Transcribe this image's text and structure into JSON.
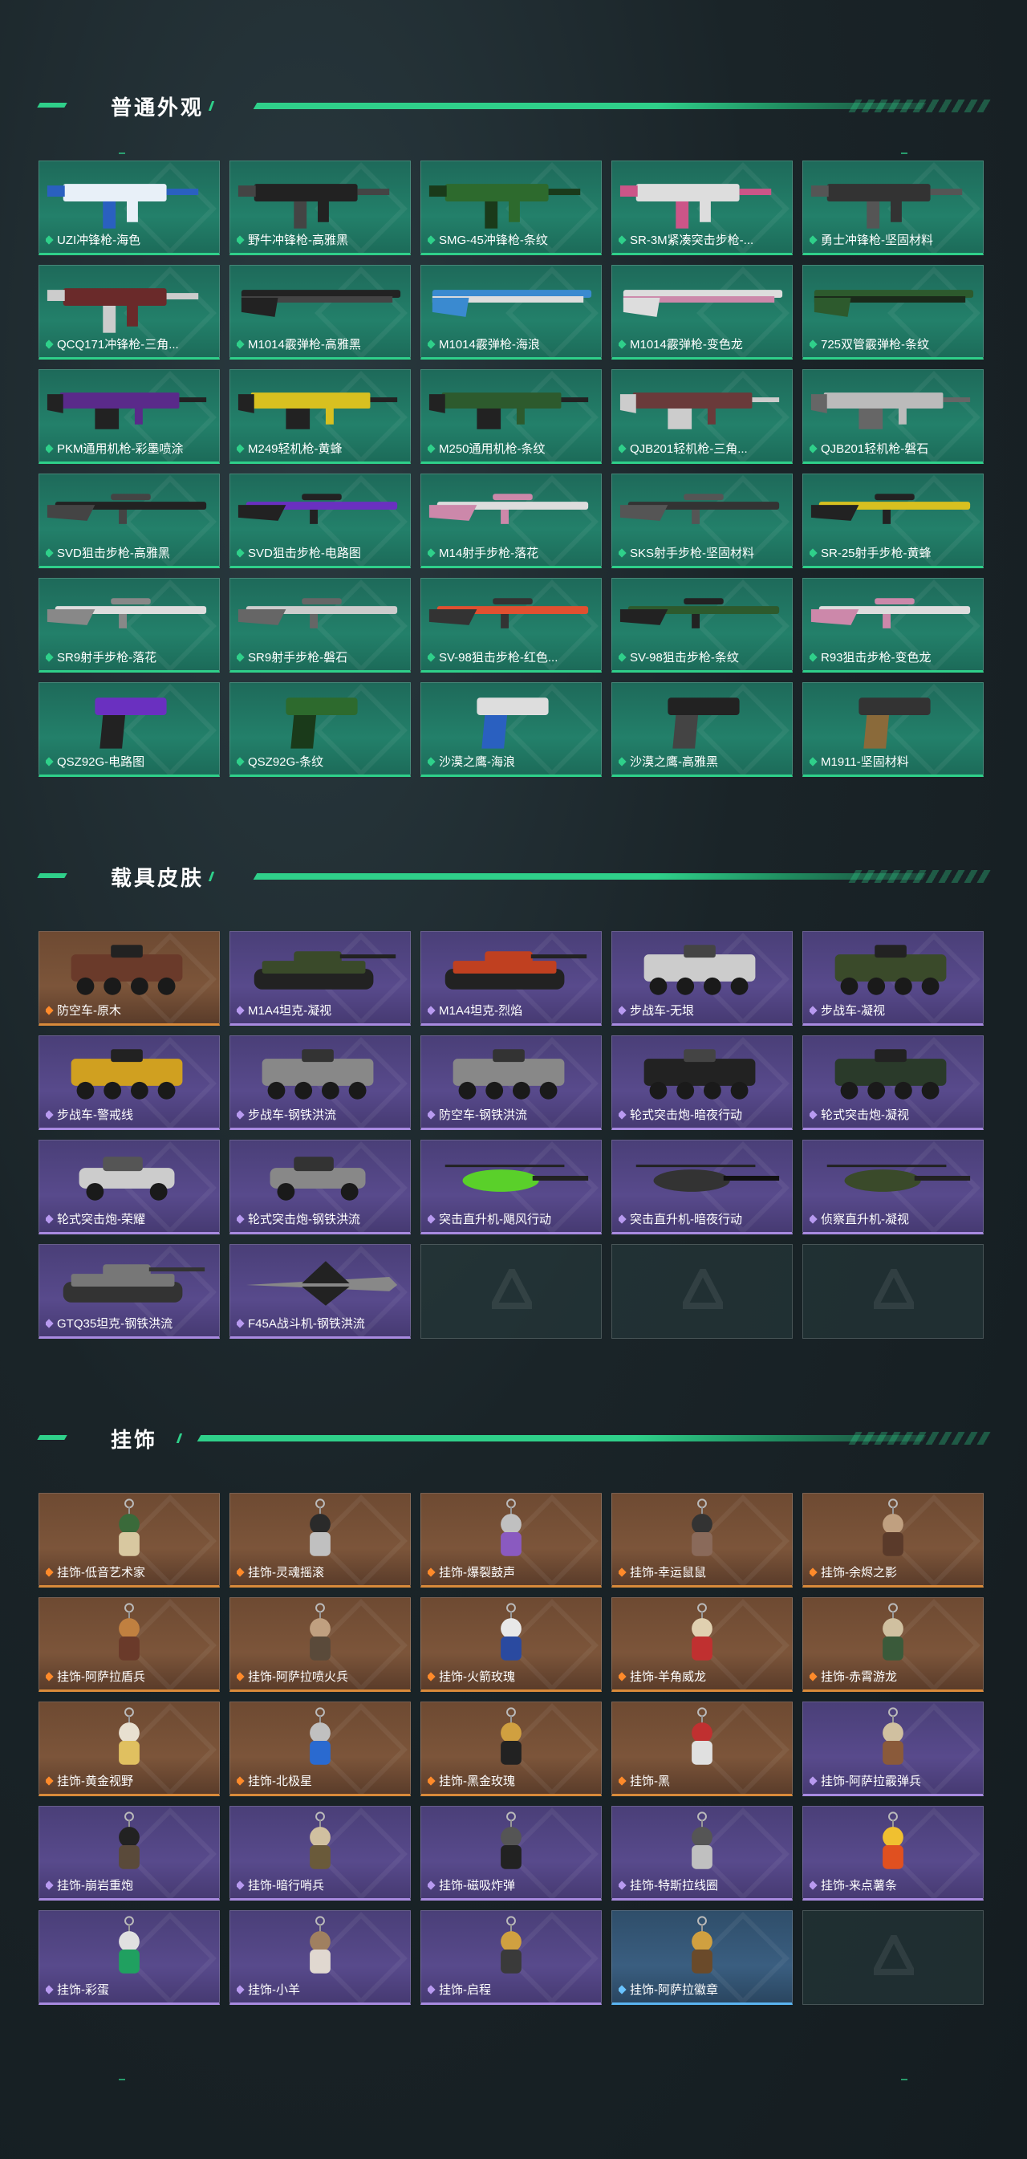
{
  "sections": {
    "weapons": {
      "title": "普通外观",
      "items": [
        {
          "label": "UZI冲锋枪-海色",
          "art": "smg",
          "colors": [
            "#e8f0f8",
            "#2a60c0"
          ]
        },
        {
          "label": "野牛冲锋枪-高雅黑",
          "art": "smg",
          "colors": [
            "#222",
            "#444"
          ]
        },
        {
          "label": "SMG-45冲锋枪-条纹",
          "art": "smg",
          "colors": [
            "#2d6a2d",
            "#1a3a1a"
          ]
        },
        {
          "label": "SR-3M紧凑突击步枪-...",
          "art": "smg",
          "colors": [
            "#ddd",
            "#c58"
          ]
        },
        {
          "label": "勇士冲锋枪-坚固材料",
          "art": "smg",
          "colors": [
            "#333",
            "#555"
          ]
        },
        {
          "label": "QCQ171冲锋枪-三角...",
          "art": "smg",
          "colors": [
            "#6a2a2a",
            "#ccc"
          ]
        },
        {
          "label": "M1014霰弹枪-高雅黑",
          "art": "shotgun",
          "colors": [
            "#222",
            "#444"
          ]
        },
        {
          "label": "M1014霰弹枪-海浪",
          "art": "shotgun",
          "colors": [
            "#3a8ad0",
            "#ddd"
          ]
        },
        {
          "label": "M1014霰弹枪-变色龙",
          "art": "shotgun",
          "colors": [
            "#ddd",
            "#c8a"
          ]
        },
        {
          "label": "725双管霰弹枪-条纹",
          "art": "shotgun",
          "colors": [
            "#2d5a2d",
            "#1a2a1a"
          ]
        },
        {
          "label": "PKM通用机枪-彩墨喷涂",
          "art": "mg",
          "colors": [
            "#5a2a8a",
            "#222"
          ]
        },
        {
          "label": "M249轻机枪-黄蜂",
          "art": "mg",
          "colors": [
            "#d8c020",
            "#222"
          ]
        },
        {
          "label": "M250通用机枪-条纹",
          "art": "mg",
          "colors": [
            "#2d5a2d",
            "#222"
          ]
        },
        {
          "label": "QJB201轻机枪-三角...",
          "art": "mg",
          "colors": [
            "#6a3a3a",
            "#ccc"
          ]
        },
        {
          "label": "QJB201轻机枪-磐石",
          "art": "mg",
          "colors": [
            "#bbb",
            "#666"
          ]
        },
        {
          "label": "SVD狙击步枪-高雅黑",
          "art": "rifle",
          "colors": [
            "#222",
            "#444"
          ]
        },
        {
          "label": "SVD狙击步枪-电路图",
          "art": "rifle",
          "colors": [
            "#6a30c0",
            "#222"
          ]
        },
        {
          "label": "M14射手步枪-落花",
          "art": "rifle",
          "colors": [
            "#ddd",
            "#c8a"
          ]
        },
        {
          "label": "SKS射手步枪-坚固材料",
          "art": "rifle",
          "colors": [
            "#333",
            "#555"
          ]
        },
        {
          "label": "SR-25射手步枪-黄蜂",
          "art": "rifle",
          "colors": [
            "#d8c020",
            "#222"
          ]
        },
        {
          "label": "SR9射手步枪-落花",
          "art": "rifle",
          "colors": [
            "#ddd",
            "#888"
          ]
        },
        {
          "label": "SR9射手步枪-磐石",
          "art": "rifle",
          "colors": [
            "#ccc",
            "#666"
          ]
        },
        {
          "label": "SV-98狙击步枪-红色...",
          "art": "rifle",
          "colors": [
            "#e05030",
            "#333"
          ]
        },
        {
          "label": "SV-98狙击步枪-条纹",
          "art": "rifle",
          "colors": [
            "#2d5a2d",
            "#222"
          ]
        },
        {
          "label": "R93狙击步枪-变色龙",
          "art": "rifle",
          "colors": [
            "#ddd",
            "#c8a"
          ]
        },
        {
          "label": "QSZ92G-电路图",
          "art": "pistol",
          "colors": [
            "#6a30c0",
            "#222"
          ]
        },
        {
          "label": "QSZ92G-条纹",
          "art": "pistol",
          "colors": [
            "#2d6a2d",
            "#1a3a1a"
          ]
        },
        {
          "label": "沙漠之鹰-海浪",
          "art": "pistol",
          "colors": [
            "#ddd",
            "#2a60c0"
          ]
        },
        {
          "label": "沙漠之鹰-高雅黑",
          "art": "pistol",
          "colors": [
            "#222",
            "#444"
          ]
        },
        {
          "label": "M1911-坚固材料",
          "art": "pistol",
          "colors": [
            "#333",
            "#8a6a3a"
          ]
        }
      ]
    },
    "vehicles": {
      "title": "载具皮肤",
      "items": [
        {
          "label": "防空车-原木",
          "tier": "orange",
          "art": "apc",
          "colors": [
            "#6a3a2a",
            "#222"
          ]
        },
        {
          "label": "M1A4坦克-凝视",
          "tier": "purple",
          "art": "tank",
          "colors": [
            "#3a4a2a",
            "#222"
          ]
        },
        {
          "label": "M1A4坦克-烈焰",
          "tier": "purple",
          "art": "tank",
          "colors": [
            "#c04020",
            "#222"
          ]
        },
        {
          "label": "步战车-无垠",
          "tier": "purple",
          "art": "apc",
          "colors": [
            "#ccc",
            "#444"
          ]
        },
        {
          "label": "步战车-凝视",
          "tier": "purple",
          "art": "apc",
          "colors": [
            "#3a4a2a",
            "#222"
          ]
        },
        {
          "label": "步战车-警戒线",
          "tier": "purple",
          "art": "apc",
          "colors": [
            "#d0a020",
            "#222"
          ]
        },
        {
          "label": "步战车-钢铁洪流",
          "tier": "purple",
          "art": "apc",
          "colors": [
            "#888",
            "#333"
          ]
        },
        {
          "label": "防空车-钢铁洪流",
          "tier": "purple",
          "art": "apc",
          "colors": [
            "#888",
            "#333"
          ]
        },
        {
          "label": "轮式突击炮-暗夜行动",
          "tier": "purple",
          "art": "apc",
          "colors": [
            "#222",
            "#444"
          ]
        },
        {
          "label": "轮式突击炮-凝视",
          "tier": "purple",
          "art": "apc",
          "colors": [
            "#2a3a2a",
            "#222"
          ]
        },
        {
          "label": "轮式突击炮-荣耀",
          "tier": "purple",
          "art": "car",
          "colors": [
            "#ccc",
            "#555"
          ]
        },
        {
          "label": "轮式突击炮-钢铁洪流",
          "tier": "purple",
          "art": "car",
          "colors": [
            "#888",
            "#333"
          ]
        },
        {
          "label": "突击直升机-飓风行动",
          "tier": "purple",
          "art": "heli",
          "colors": [
            "#5ad02a",
            "#222"
          ]
        },
        {
          "label": "突击直升机-暗夜行动",
          "tier": "purple",
          "art": "heli",
          "colors": [
            "#333",
            "#111"
          ]
        },
        {
          "label": "侦察直升机-凝视",
          "tier": "purple",
          "art": "heli",
          "colors": [
            "#3a4a2a",
            "#222"
          ]
        },
        {
          "label": "GTQ35坦克-钢铁洪流",
          "tier": "purple",
          "art": "tank",
          "colors": [
            "#777",
            "#333"
          ]
        },
        {
          "label": "F45A战斗机-钢铁洪流",
          "tier": "purple",
          "art": "jet",
          "colors": [
            "#888",
            "#222"
          ]
        },
        {
          "label": "",
          "tier": "empty"
        },
        {
          "label": "",
          "tier": "empty"
        },
        {
          "label": "",
          "tier": "empty"
        }
      ]
    },
    "charms": {
      "title": "挂饰",
      "items": [
        {
          "label": "挂饰-低音艺术家",
          "tier": "orange",
          "colors": [
            "#d8c8a0",
            "#3a6a3a"
          ]
        },
        {
          "label": "挂饰-灵魂摇滚",
          "tier": "orange",
          "colors": [
            "#c0c0c0",
            "#2a2a2a"
          ]
        },
        {
          "label": "挂饰-爆裂鼓声",
          "tier": "orange",
          "colors": [
            "#8a5ac0",
            "#c0c0c0"
          ]
        },
        {
          "label": "挂饰-幸运鼠鼠",
          "tier": "orange",
          "colors": [
            "#8a6a5a",
            "#333"
          ]
        },
        {
          "label": "挂饰-余烬之影",
          "tier": "orange",
          "colors": [
            "#5a3a2a",
            "#c0a080"
          ]
        },
        {
          "label": "挂饰-阿萨拉盾兵",
          "tier": "orange",
          "colors": [
            "#6a3a2a",
            "#c08040"
          ]
        },
        {
          "label": "挂饰-阿萨拉喷火兵",
          "tier": "orange",
          "colors": [
            "#5a4a3a",
            "#c0a080"
          ]
        },
        {
          "label": "挂饰-火箭玫瑰",
          "tier": "orange",
          "colors": [
            "#2a4aa0",
            "#e8e8e8"
          ]
        },
        {
          "label": "挂饰-羊角威龙",
          "tier": "orange",
          "colors": [
            "#c03030",
            "#e0d0b0"
          ]
        },
        {
          "label": "挂饰-赤霄游龙",
          "tier": "orange",
          "colors": [
            "#3a5a3a",
            "#d0c0a0"
          ]
        },
        {
          "label": "挂饰-黄金视野",
          "tier": "orange",
          "colors": [
            "#e0c060",
            "#e8e0d0"
          ]
        },
        {
          "label": "挂饰-北极星",
          "tier": "orange",
          "colors": [
            "#2a6ad0",
            "#c0c0c0"
          ]
        },
        {
          "label": "挂饰-黑金玫瑰",
          "tier": "orange",
          "colors": [
            "#222",
            "#d0a040"
          ]
        },
        {
          "label": "挂饰-黑",
          "tier": "orange",
          "colors": [
            "#e0e0e0",
            "#c03030"
          ]
        },
        {
          "label": "挂饰-阿萨拉霰弹兵",
          "tier": "purple",
          "colors": [
            "#8a5a3a",
            "#d0c0a0"
          ]
        },
        {
          "label": "挂饰-崩岩重炮",
          "tier": "purple",
          "colors": [
            "#5a4a3a",
            "#222"
          ]
        },
        {
          "label": "挂饰-暗行哨兵",
          "tier": "purple",
          "colors": [
            "#6a5a3a",
            "#d0c0a0"
          ]
        },
        {
          "label": "挂饰-磁吸炸弹",
          "tier": "purple",
          "colors": [
            "#222",
            "#555"
          ]
        },
        {
          "label": "挂饰-特斯拉线圈",
          "tier": "purple",
          "colors": [
            "#c0c0c0",
            "#555"
          ]
        },
        {
          "label": "挂饰-来点薯条",
          "tier": "purple",
          "colors": [
            "#e05020",
            "#f0c030"
          ]
        },
        {
          "label": "挂饰-彩蛋",
          "tier": "purple",
          "colors": [
            "#20a060",
            "#e0e0e0"
          ]
        },
        {
          "label": "挂饰-小羊",
          "tier": "purple",
          "colors": [
            "#e0d8d0",
            "#a08060"
          ]
        },
        {
          "label": "挂饰-启程",
          "tier": "purple",
          "colors": [
            "#3a3a3a",
            "#d0a040"
          ]
        },
        {
          "label": "挂饰-阿萨拉徽章",
          "tier": "blue",
          "colors": [
            "#6a4a2a",
            "#d0a040"
          ]
        },
        {
          "label": "",
          "tier": "empty"
        }
      ]
    }
  }
}
